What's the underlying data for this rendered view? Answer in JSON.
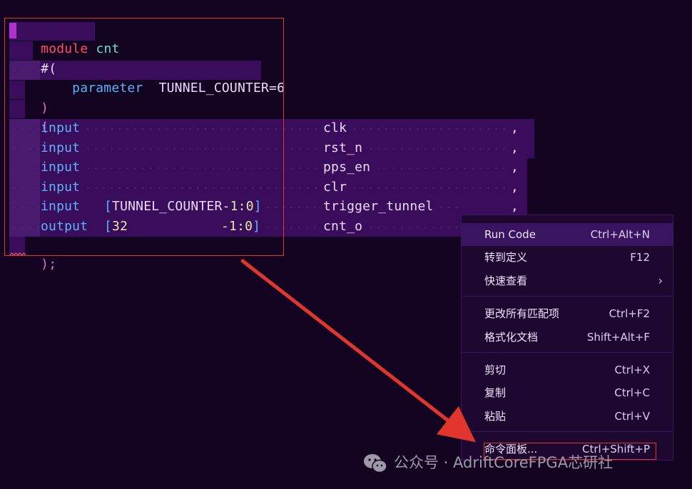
{
  "code": {
    "module_keyword": "module",
    "module_name": "cnt",
    "hash_paren": "#(",
    "param_keyword": "parameter",
    "param_assign": "TUNNEL_COUNTER=6",
    "close_paren": ")",
    "open_paren": "(",
    "close_semicolon": ");",
    "ports": [
      {
        "dir": "input",
        "range_open": "",
        "range_name": "",
        "range_lo": "",
        "range_close": "",
        "name": "clk",
        "comma": ","
      },
      {
        "dir": "input",
        "range_open": "",
        "range_name": "",
        "range_lo": "",
        "range_close": "",
        "name": "rst_n",
        "comma": ","
      },
      {
        "dir": "input",
        "range_open": "",
        "range_name": "",
        "range_lo": "",
        "range_close": "",
        "name": "pps_en",
        "comma": ","
      },
      {
        "dir": "input",
        "range_open": "",
        "range_name": "",
        "range_lo": "",
        "range_close": "",
        "name": "clr",
        "comma": ","
      },
      {
        "dir": "input",
        "range_open": "[",
        "range_name": "TUNNEL_COUNTER",
        "range_lo": "-1:0",
        "range_close": "]",
        "name": "trigger_tunnel",
        "comma": ","
      },
      {
        "dir": "output",
        "range_open": "[",
        "range_name": "32",
        "range_lo": "-1:0",
        "range_close": "]",
        "name": "cnt_o",
        "comma": ""
      }
    ]
  },
  "context_menu": {
    "groups": [
      [
        {
          "label": "Run Code",
          "shortcut": "Ctrl+Alt+N",
          "submenu": false
        },
        {
          "label": "转到定义",
          "shortcut": "F12",
          "submenu": false
        },
        {
          "label": "快速查看",
          "shortcut": "",
          "submenu": true
        }
      ],
      [
        {
          "label": "更改所有匹配项",
          "shortcut": "Ctrl+F2",
          "submenu": false
        },
        {
          "label": "格式化文档",
          "shortcut": "Shift+Alt+F",
          "submenu": false
        }
      ],
      [
        {
          "label": "剪切",
          "shortcut": "Ctrl+X",
          "submenu": false
        },
        {
          "label": "复制",
          "shortcut": "Ctrl+C",
          "submenu": false
        },
        {
          "label": "粘贴",
          "shortcut": "Ctrl+V",
          "submenu": false
        }
      ],
      [
        {
          "label": "命令面板...",
          "shortcut": "Ctrl+Shift+P",
          "submenu": false
        }
      ]
    ]
  },
  "watermark": {
    "text": "公众号 · AdriftCoreFPGA芯研社",
    "icon": "wechat-icon"
  },
  "colors": {
    "background": "#130421",
    "selection": "#3a0d5c",
    "annotation_red": "#e0362d",
    "keyword_red": "#ff4f6a",
    "keyword_blue": "#5cb3f5",
    "identifier_teal": "#6ee0c8"
  }
}
